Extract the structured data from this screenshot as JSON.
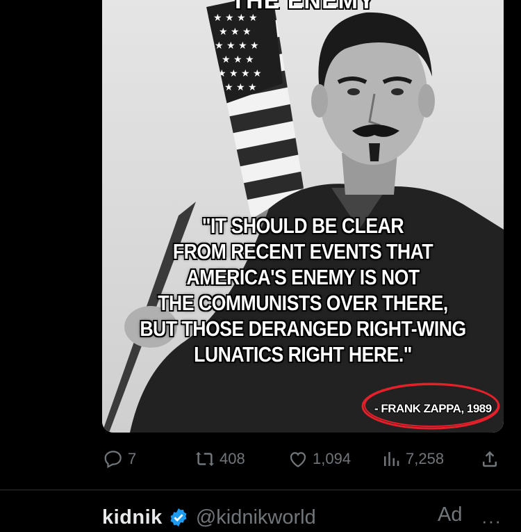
{
  "media": {
    "header_text": "THE ENEMY",
    "quote_lines": [
      "\"IT SHOULD BE CLEAR",
      "FROM RECENT EVENTS THAT",
      "AMERICA'S ENEMY IS NOT",
      "THE COMMUNISTS OVER THERE,",
      "BUT THOSE DERANGED RIGHT-WING",
      "LUNATICS RIGHT HERE.\""
    ],
    "attribution": "- FRANK ZAPPA, 1989",
    "highlight_color": "#e4202a"
  },
  "actions": {
    "reply": {
      "icon": "reply-icon",
      "count": "7"
    },
    "repost": {
      "icon": "repost-icon",
      "count": "408"
    },
    "like": {
      "icon": "heart-icon",
      "count": "1,094"
    },
    "views": {
      "icon": "views-icon",
      "count": "7,258"
    },
    "share": {
      "icon": "share-icon"
    }
  },
  "next_tweet": {
    "display_name": "kidnik",
    "handle": "@kidnikworld",
    "ad_label": "Ad",
    "more": "···",
    "verified_color": "#1d9bf0"
  },
  "colors": {
    "background": "#000000",
    "text_muted": "#71767b",
    "text_primary": "#e7e9ea"
  }
}
